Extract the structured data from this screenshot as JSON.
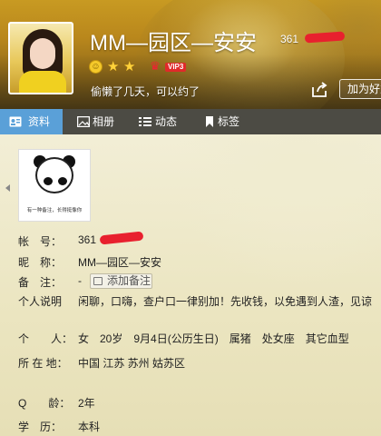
{
  "header": {
    "nickname": "MM—园区—安安",
    "qq_number": "361",
    "signature": "偷懒了几天，可以约了",
    "vip_label": "VIP3",
    "add_friend_label": "加为好友",
    "colors": {
      "accent": "#5aa0d8",
      "vip": "#e02a2a",
      "redaction": "#e8202e"
    }
  },
  "tabs": [
    {
      "label": "资料",
      "icon": "profile-card-icon",
      "active": true
    },
    {
      "label": "相册",
      "icon": "photo-album-icon",
      "active": false
    },
    {
      "label": "动态",
      "icon": "feed-list-icon",
      "active": false
    },
    {
      "label": "标签",
      "icon": "bookmark-tag-icon",
      "active": false
    }
  ],
  "photo_caption": "有一种备注，长得挺像你",
  "profile": {
    "account": {
      "label": "帐　号：",
      "value": "361"
    },
    "nickname": {
      "label": "昵　称：",
      "value": "MM—园区—安安"
    },
    "memo": {
      "label": "备　注：",
      "value": "-",
      "button": "添加备注"
    },
    "personal_note": {
      "label": "个人说明",
      "value": "闲聊，口嗨，查户口一律别加！先收钱，以免遇到人渣，见谅"
    },
    "person": {
      "label": "个　　人：",
      "value": "女　20岁　9月4日(公历生日)　属猪　处女座　其它血型"
    },
    "location": {
      "label": "所 在 地：",
      "value": "中国 江苏 苏州 姑苏区"
    },
    "q_age": {
      "label": "Q　　龄：",
      "value": "2年"
    },
    "education": {
      "label": "学　历：",
      "value": "本科"
    }
  }
}
